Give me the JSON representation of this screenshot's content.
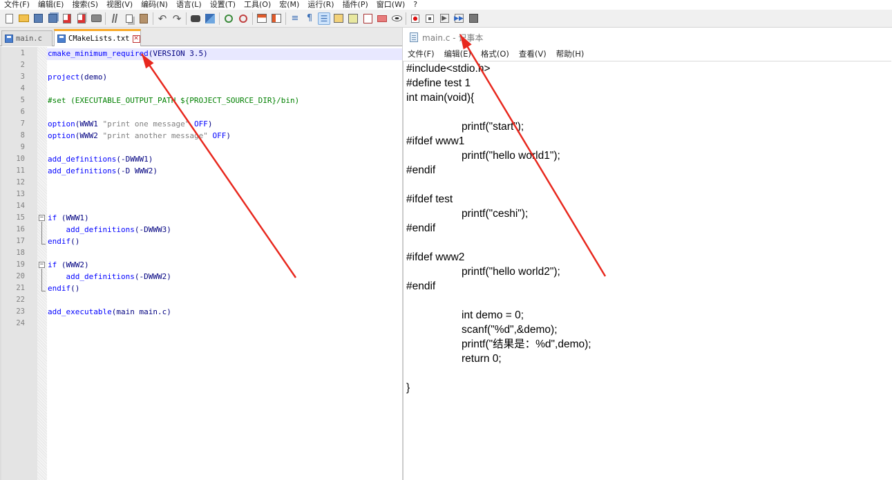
{
  "npp_menu": [
    "文件(F)",
    "编辑(E)",
    "搜索(S)",
    "视图(V)",
    "编码(N)",
    "语言(L)",
    "设置(T)",
    "工具(O)",
    "宏(M)",
    "运行(R)",
    "插件(P)",
    "窗口(W)",
    "?"
  ],
  "tabs": [
    {
      "label": "main.c",
      "active": false
    },
    {
      "label": "CMakeLists.txt",
      "active": true,
      "close": "✕"
    }
  ],
  "editor": {
    "line_numbers": [
      "1",
      "2",
      "3",
      "4",
      "5",
      "6",
      "7",
      "8",
      "9",
      "10",
      "11",
      "12",
      "13",
      "14",
      "15",
      "16",
      "17",
      "18",
      "19",
      "20",
      "21",
      "22",
      "23",
      "24"
    ],
    "lines": [
      {
        "ln": "1",
        "parts": [
          [
            "kw",
            "cmake_minimum_required"
          ],
          [
            "p",
            "(VERSION 3.5)"
          ]
        ]
      },
      {
        "ln": "2",
        "parts": []
      },
      {
        "ln": "3",
        "parts": [
          [
            "kw",
            "project"
          ],
          [
            "p",
            "(demo)"
          ]
        ]
      },
      {
        "ln": "4",
        "parts": []
      },
      {
        "ln": "5",
        "parts": [
          [
            "c",
            "#set (EXECUTABLE_OUTPUT_PATH ${PROJECT_SOURCE_DIR}/bin)"
          ]
        ]
      },
      {
        "ln": "6",
        "parts": []
      },
      {
        "ln": "7",
        "parts": [
          [
            "kw",
            "option"
          ],
          [
            "p",
            "(WWW1 "
          ],
          [
            "s",
            "\"print one message\""
          ],
          [
            "p",
            " "
          ],
          [
            "kw",
            "OFF"
          ],
          [
            "p",
            ")"
          ]
        ]
      },
      {
        "ln": "8",
        "parts": [
          [
            "kw",
            "option"
          ],
          [
            "p",
            "(WWW2 "
          ],
          [
            "s",
            "\"print another message\""
          ],
          [
            "p",
            " "
          ],
          [
            "kw",
            "OFF"
          ],
          [
            "p",
            ")"
          ]
        ]
      },
      {
        "ln": "9",
        "parts": []
      },
      {
        "ln": "10",
        "parts": [
          [
            "kw",
            "add_definitions"
          ],
          [
            "p",
            "(-DWWW1)"
          ]
        ]
      },
      {
        "ln": "11",
        "parts": [
          [
            "kw",
            "add_definitions"
          ],
          [
            "p",
            "(-D WWW2)"
          ]
        ]
      },
      {
        "ln": "12",
        "parts": []
      },
      {
        "ln": "13",
        "parts": []
      },
      {
        "ln": "14",
        "parts": []
      },
      {
        "ln": "15",
        "parts": [
          [
            "kw",
            "if"
          ],
          [
            "p",
            " (WWW1)"
          ]
        ]
      },
      {
        "ln": "16",
        "parts": [
          [
            "p",
            "    "
          ],
          [
            "kw",
            "add_definitions"
          ],
          [
            "p",
            "(-DWWW3)"
          ]
        ]
      },
      {
        "ln": "17",
        "parts": [
          [
            "kw",
            "endif"
          ],
          [
            "p",
            "()"
          ]
        ]
      },
      {
        "ln": "18",
        "parts": []
      },
      {
        "ln": "19",
        "parts": [
          [
            "kw",
            "if"
          ],
          [
            "p",
            " (WWW2)"
          ]
        ]
      },
      {
        "ln": "20",
        "parts": [
          [
            "p",
            "    "
          ],
          [
            "kw",
            "add_definitions"
          ],
          [
            "p",
            "(-DWWW2)"
          ]
        ]
      },
      {
        "ln": "21",
        "parts": [
          [
            "kw",
            "endif"
          ],
          [
            "p",
            "()"
          ]
        ]
      },
      {
        "ln": "22",
        "parts": []
      },
      {
        "ln": "23",
        "parts": [
          [
            "kw",
            "add_executable"
          ],
          [
            "p",
            "(main main.c)"
          ]
        ]
      },
      {
        "ln": "24",
        "parts": []
      }
    ]
  },
  "notepad": {
    "title": "main.c - 记事本",
    "menu": [
      "文件(F)",
      "编辑(E)",
      "格式(O)",
      "查看(V)",
      "帮助(H)"
    ],
    "lines": [
      "#include<stdio.h>",
      "#define test 1",
      "int main(void){",
      "",
      "\t\tprintf(\"start\");",
      "#ifdef www1",
      "\t\tprintf(\"hello world1\");",
      "#endif",
      "",
      "#ifdef test",
      "\t\tprintf(\"ceshi\");",
      "#endif",
      "",
      "#ifdef www2",
      "\t\tprintf(\"hello world2\");",
      "#endif",
      "",
      "\t\tint demo = 0;",
      "\t\tscanf(\"%d\",&demo);",
      "\t\tprintf(\"结果是：%d\",demo);",
      "\t\treturn 0;",
      "",
      "}"
    ]
  },
  "annotation_color": "#e8281e"
}
